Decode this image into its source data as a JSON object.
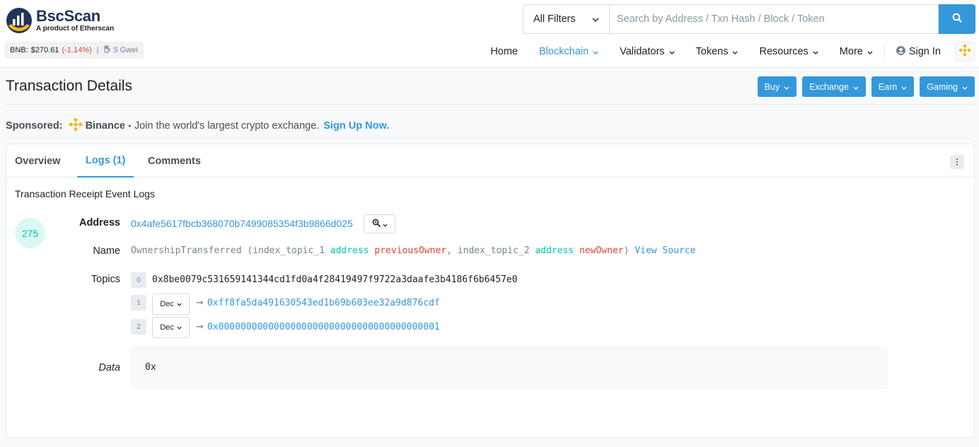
{
  "header": {
    "logo_name": "BscScan",
    "logo_sub": "A product of Etherscan",
    "bnb_price_label": "BNB:",
    "bnb_price": "$270.61",
    "bnb_change": "(-1.14%)",
    "gas": "5 Gwei",
    "filter_label": "All Filters",
    "search_placeholder": "Search by Address / Txn Hash / Block / Token",
    "nav": {
      "home": "Home",
      "blockchain": "Blockchain",
      "validators": "Validators",
      "tokens": "Tokens",
      "resources": "Resources",
      "more": "More",
      "signin": "Sign In"
    }
  },
  "page": {
    "title": "Transaction Details",
    "buttons": {
      "buy": "Buy",
      "exchange": "Exchange",
      "earn": "Earn",
      "gaming": "Gaming"
    }
  },
  "sponsored": {
    "label": "Sponsored:",
    "brand": "Binance -",
    "message": "Join the world's largest crypto exchange.",
    "cta": "Sign Up Now."
  },
  "tabs": {
    "overview": "Overview",
    "logs": "Logs (1)",
    "comments": "Comments"
  },
  "logs": {
    "section_title": "Transaction Receipt Event Logs",
    "index": "275",
    "address_label": "Address",
    "address": "0x4afe5617fbcb368070b7499085354f3b9866d025",
    "name_label": "Name",
    "name_fn": "OwnershipTransferred",
    "name_open": "(index_topic_1",
    "name_kw1": "address",
    "name_param1": "previousOwner",
    "name_mid": ", index_topic_2",
    "name_kw2": "address",
    "name_param2": "newOwner",
    "name_close": ")",
    "view_source": "View Source",
    "topics_label": "Topics",
    "topics": [
      {
        "index": "0",
        "value": "0x8be0079c531659141344cd1fd0a4f28419497f9722a3daafe3b4186f6b6457e0"
      },
      {
        "index": "1",
        "format": "Dec",
        "value": "0xff8fa5da491630543ed1b69b603ee32a9d876cdf"
      },
      {
        "index": "2",
        "format": "Dec",
        "value": "0x0000000000000000000000000000000000000001"
      }
    ],
    "data_label": "Data",
    "data_value": "0x"
  },
  "colors": {
    "brand_blue": "#3498db",
    "negative": "#de4437",
    "success": "#00c9a7",
    "bnb_yellow": "#f0b90b"
  }
}
